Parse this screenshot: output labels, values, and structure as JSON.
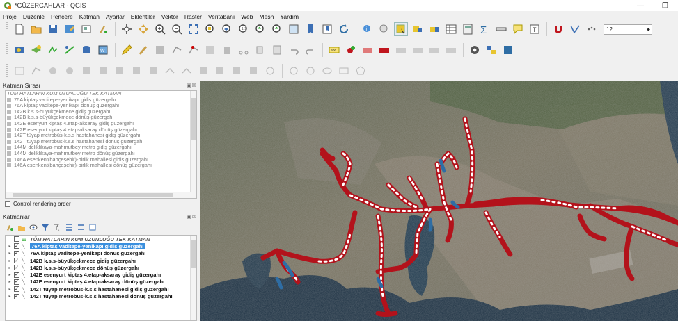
{
  "window": {
    "title": "*GÜZERGAHLAR - QGIS",
    "minimize": "—",
    "maximize": "❐"
  },
  "menu": [
    "Proje",
    "Düzenle",
    "Pencere",
    "Katman",
    "Ayarlar",
    "Eklentiler",
    "Vektör",
    "Raster",
    "Veritabanı",
    "Web",
    "Mesh",
    "Yardım"
  ],
  "toolbar": {
    "scale_value": "12"
  },
  "layer_order": {
    "title": "Katman Sırası",
    "items": [
      "TÜM HATLARIN KUM UZUNLUĞU TEK KATMAN",
      "76A kiptaş vaditepe-yenikapı gidiş güzergahı",
      "76A kiptaş vaditepe-yenikapı dönüş güzergahı",
      "142B k.s.s-büyükçekmece gidiş güzergahı",
      "142B k.s.s-büyükçekmece dönüş güzergahı",
      "142E esenyurt kiptaş 4.etap-aksaray gidiş güzergahı",
      "142E esenyurt kiptaş 4.etap-aksaray dönüş güzergahı",
      "142T tüyap metrobüs-k.s.s hastahanesi gidiş güzergahı",
      "142T tüyap metrobüs-k.s.s hastahanesi dönüş güzergahı",
      "144M deliklikaya-mahmutbey metro gidiş güzergahı",
      "144M deliklikaya-mahmutbey metro dönüş güzergahı",
      "146A esenkent(bahçeşehir)-birlik mahallesi gidiş güzergahı",
      "146A esenkent(bahçeşehir)-birlik mahallesi dönüş güzergahı"
    ]
  },
  "control_rendering": {
    "label": "Control rendering order"
  },
  "layers": {
    "title": "Katmanlar",
    "items": [
      {
        "label": "TÜM HATLARIN KUM UZUNLUĞU TEK KATMAN",
        "checked": ""
      },
      {
        "label": "76A kiptaş vaditepe-yenikapı gidiş güzergahı",
        "checked": "✓"
      },
      {
        "label": "76A kiptaş vaditepe-yenikapı dönüş güzergahı",
        "checked": "✓"
      },
      {
        "label": "142B k.s.s-büyükçekmece gidiş güzergahı",
        "checked": "✓"
      },
      {
        "label": "142B k.s.s-büyükçekmece dönüş güzergahı",
        "checked": "✓"
      },
      {
        "label": "142E esenyurt kiptaş 4.etap-aksaray gidiş güzergahı",
        "checked": "✓"
      },
      {
        "label": "142E esenyurt kiptaş 4.etap-aksaray dönüş güzergahı",
        "checked": "✓"
      },
      {
        "label": "142T tüyap metrobüs-k.s.s hastahanesi gidiş güzergahı",
        "checked": "✓"
      },
      {
        "label": "142T tüyap metrobüs-k.s.s hastahanesi dönüş güzergahı",
        "checked": "✓"
      }
    ]
  },
  "colors": {
    "route_red": "#b3121b",
    "route_white": "#ffffff",
    "route_blue": "#2e6da4",
    "water": "#1b3042",
    "land": "#6f6a58",
    "selection": "#3a8fde"
  },
  "icons": [
    "new-project-icon",
    "open-project-icon",
    "save-project-icon",
    "pan-icon",
    "zoom-in-icon",
    "zoom-out-icon",
    "identify-icon",
    "select-icon",
    "attribute-table-icon",
    "field-calculator-icon",
    "sum-icon",
    "measure-icon",
    "annotation-icon",
    "magnet-icon"
  ]
}
